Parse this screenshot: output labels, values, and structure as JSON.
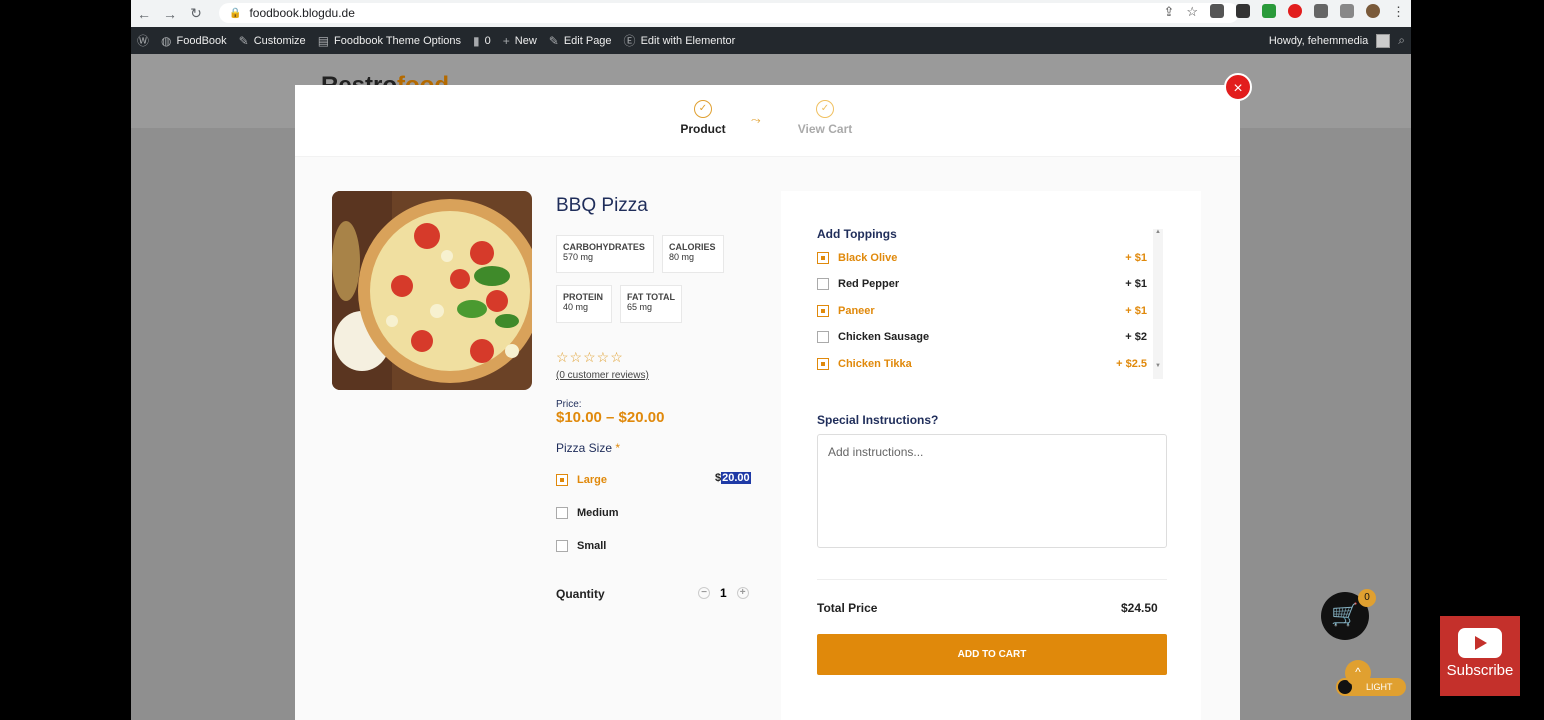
{
  "browser": {
    "url": "foodbook.blogdu.de"
  },
  "adminbar": {
    "items": [
      "FoodBook",
      "Customize",
      "Foodbook Theme Options",
      "0",
      "New",
      "Edit Page",
      "Edit with Elementor"
    ],
    "greeting": "Howdy, fehemmedia"
  },
  "site": {
    "logo_a": "Restro",
    "logo_b": "food"
  },
  "modal": {
    "close": "×",
    "steps": [
      {
        "label": "Product",
        "icon": "✓"
      },
      {
        "label": "View Cart",
        "icon": "✓"
      }
    ],
    "product": {
      "title": "BBQ Pizza",
      "nutrition": [
        {
          "name": "CARBOHYDRATES",
          "value": "570 mg"
        },
        {
          "name": "CALORIES",
          "value": "80 mg"
        },
        {
          "name": "PROTEIN",
          "value": "40 mg"
        },
        {
          "name": "FAT TOTAL",
          "value": "65 mg"
        }
      ],
      "stars": "☆☆☆☆☆",
      "reviews": "(0 customer reviews)",
      "price_label": "Price:",
      "price": "$10.00 – $20.00",
      "size_label": "Pizza Size",
      "size_req": "*",
      "sizes": [
        {
          "label": "Large",
          "selected": true
        },
        {
          "label": "Medium",
          "selected": false
        },
        {
          "label": "Small",
          "selected": false
        }
      ],
      "size_price_prefix": "$",
      "size_price_sel": "20.00",
      "quantity_label": "Quantity",
      "quantity": "1",
      "minus": "−",
      "plus": "+"
    },
    "toppings": {
      "title": "Add Toppings",
      "items": [
        {
          "name": "Black Olive",
          "price": "+ $1",
          "selected": true
        },
        {
          "name": "Red Pepper",
          "price": "+ $1",
          "selected": false
        },
        {
          "name": "Paneer",
          "price": "+ $1",
          "selected": true
        },
        {
          "name": "Chicken Sausage",
          "price": "+ $2",
          "selected": false
        },
        {
          "name": "Chicken Tikka",
          "price": "+ $2.5",
          "selected": true
        }
      ]
    },
    "instructions": {
      "title": "Special Instructions?",
      "placeholder": "Add instructions..."
    },
    "total_label": "Total Price",
    "total_value": "$24.50",
    "add_to_cart": "ADD TO CART"
  },
  "floating": {
    "cart_count": "0",
    "light": "LIGHT",
    "up": "^"
  },
  "youtube": {
    "label": "Subscribe"
  },
  "colors": {
    "accent": "#e0890b",
    "navy": "#1f2d5a",
    "close": "#e21d1d",
    "youtube": "#c4302b"
  }
}
